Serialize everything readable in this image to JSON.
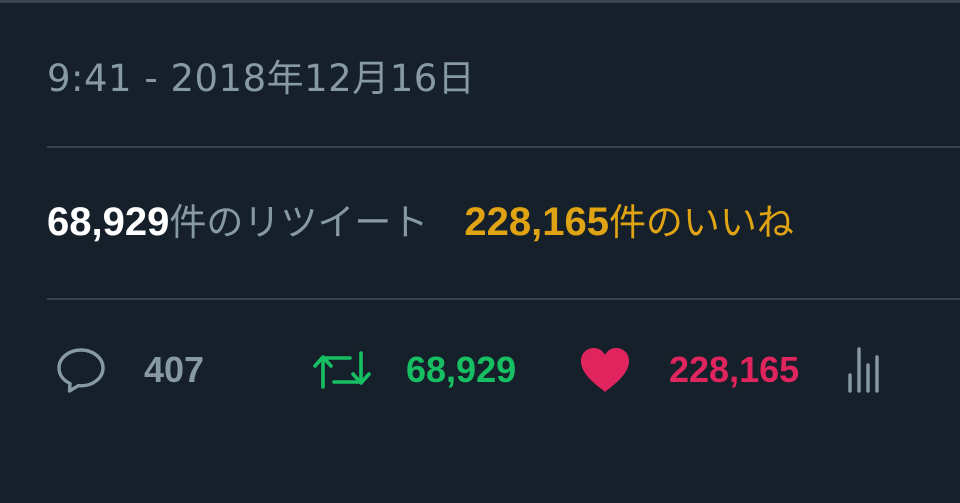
{
  "tweet": {
    "timestamp": "9:41 - 2018年12月16日"
  },
  "stats": {
    "retweets_number": "68,929",
    "retweets_label": "件のリツイート",
    "likes_number": "228,165",
    "likes_label": "件のいいね"
  },
  "actions": {
    "reply_count": "407",
    "retweet_count": "68,929",
    "like_count": "228,165",
    "reply_icon": "reply-icon",
    "retweet_icon": "retweet-icon",
    "like_icon": "heart-icon",
    "analytics_icon": "analytics-icon"
  },
  "colors": {
    "background": "#15202b",
    "muted_text": "#8899a6",
    "divider": "#38444d",
    "retweet_green": "#17bf63",
    "like_red": "#e0245e",
    "likes_stat_gold": "#e0a313"
  }
}
